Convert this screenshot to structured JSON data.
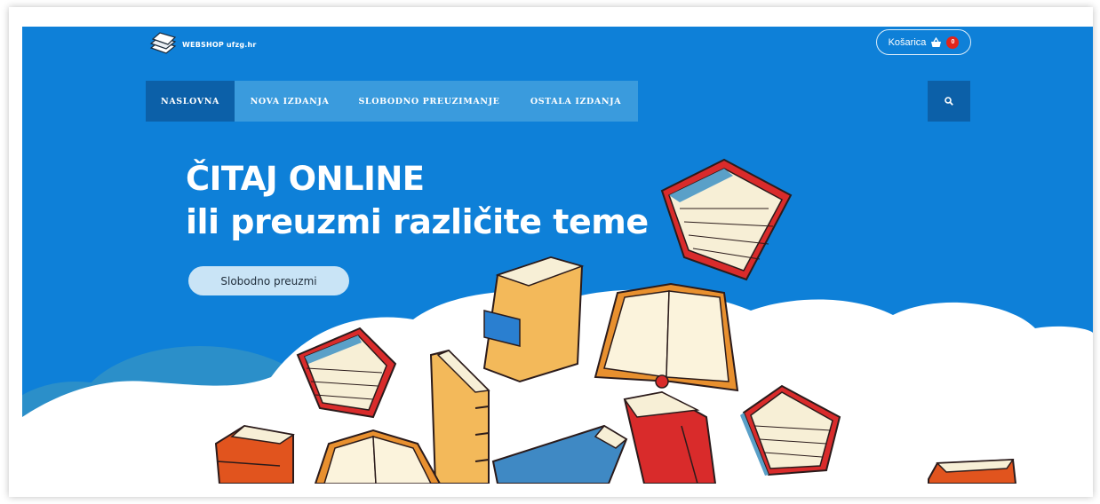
{
  "site": {
    "logo_text": "WEBSHOP ufzg.hr"
  },
  "header": {
    "cart_label": "Košarica",
    "cart_count": "0"
  },
  "nav": {
    "items": [
      {
        "label": "NASLOVNA",
        "active": true
      },
      {
        "label": "NOVA IZDANJA",
        "active": false
      },
      {
        "label": "SLOBODNO PREUZIMANJE",
        "active": false
      },
      {
        "label": "OSTALA IZDANJA",
        "active": false
      }
    ],
    "search_icon": "search-icon"
  },
  "hero": {
    "title_line1": "ČITAJ ONLINE",
    "title_line2": "ili preuzmi različite teme",
    "cta_label": "Slobodno preuzmi",
    "illustration": "flying-books-illustration"
  },
  "colors": {
    "hero_bg": "#0e80d8",
    "nav_bg": "#3a9bdd",
    "nav_active": "#0c60a8",
    "cta_bg": "#c9e4f6",
    "badge": "#e1251b"
  }
}
